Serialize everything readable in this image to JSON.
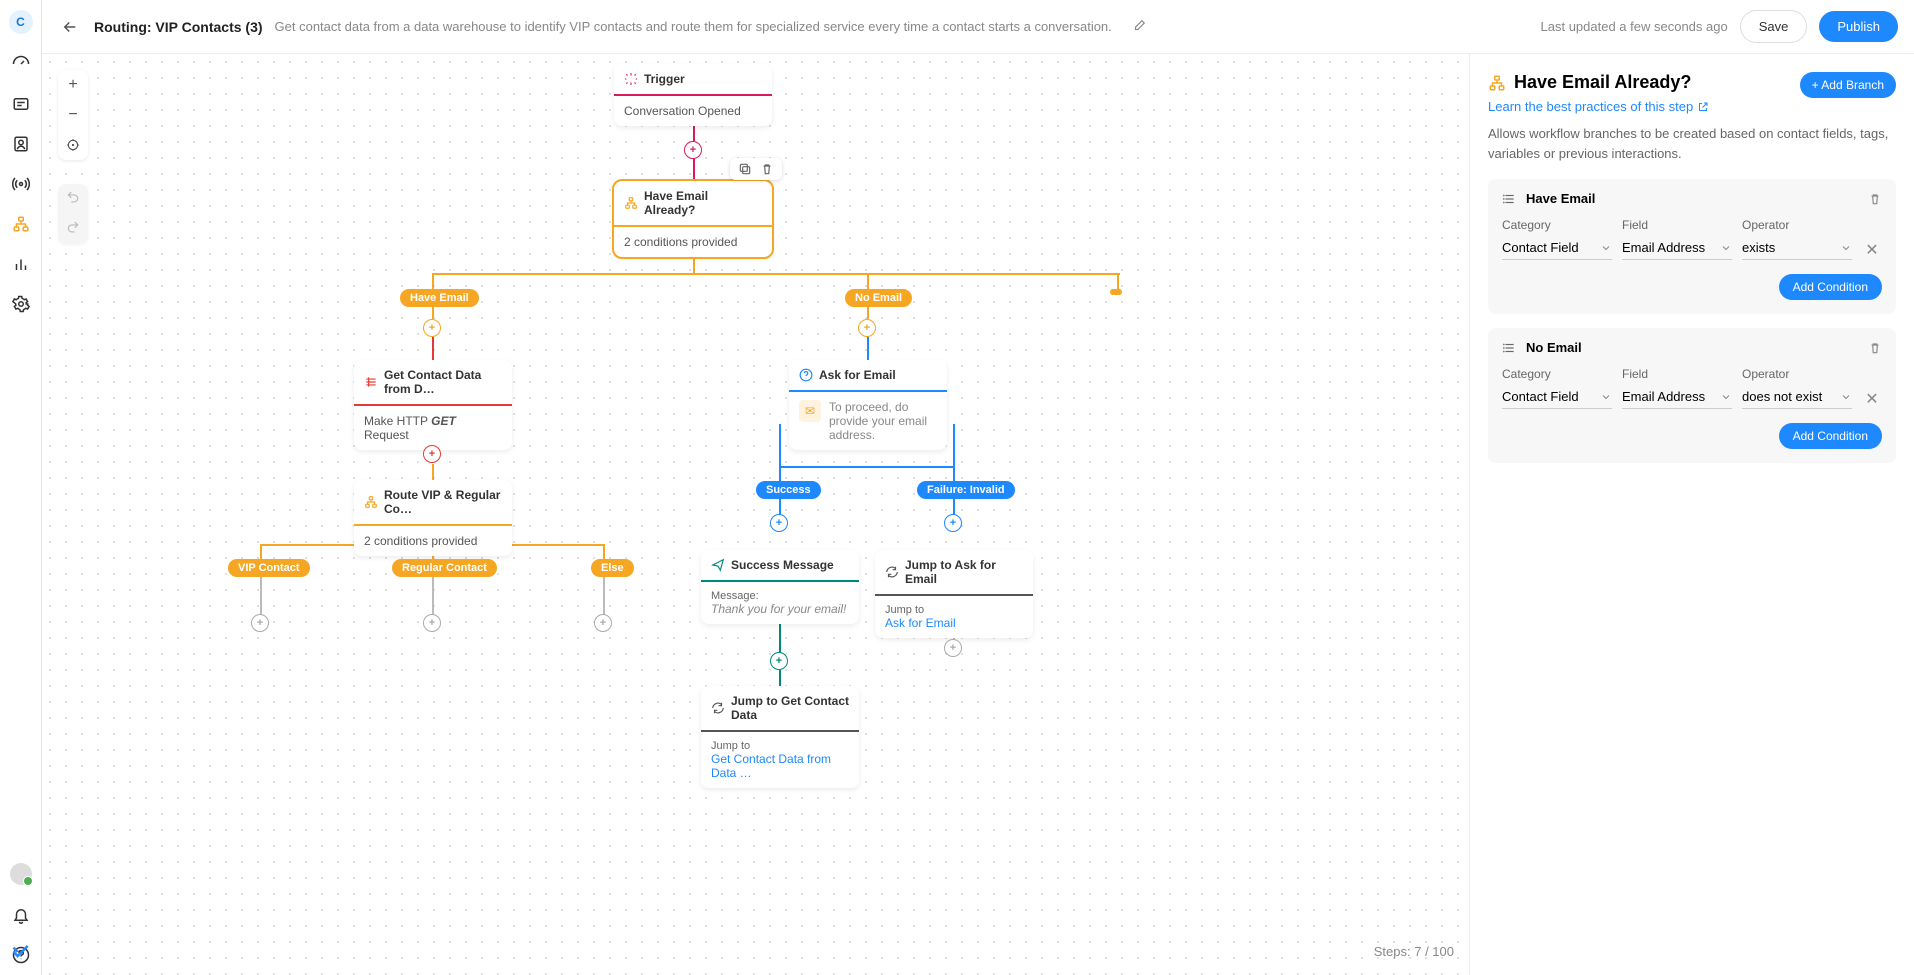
{
  "sidebar": {
    "logo_letter": "C"
  },
  "topbar": {
    "title": "Routing: VIP Contacts (3)",
    "description": "Get contact data from a data warehouse to identify VIP contacts and route them for specialized service every time a contact starts a conversation.",
    "last_updated": "Last updated a few seconds ago",
    "save_label": "Save",
    "publish_label": "Publish"
  },
  "nodes": {
    "trigger": {
      "title": "Trigger",
      "body": "Conversation Opened"
    },
    "have_email_branch": {
      "title": "Have Email Already?",
      "body": "2 conditions provided"
    },
    "get_contact": {
      "title": "Get Contact Data from D…",
      "line1_a": "Make HTTP ",
      "line1_b": "GET",
      "line1_c": " Request"
    },
    "route_vip": {
      "title": "Route VIP & Regular Co…",
      "body": "2 conditions provided"
    },
    "ask_email": {
      "title": "Ask for Email",
      "body": "To proceed, do provide your email address."
    },
    "success_msg": {
      "title": "Success Message",
      "label": "Message:",
      "content": "Thank you for your email!"
    },
    "jump_ask": {
      "title": "Jump to Ask for Email",
      "label": "Jump to",
      "target": "Ask for Email"
    },
    "jump_get": {
      "title": "Jump to Get Contact Data",
      "label": "Jump to",
      "target": "Get Contact Data from Data …"
    }
  },
  "pills": {
    "have_email": "Have Email",
    "no_email": "No Email",
    "vip": "VIP Contact",
    "regular": "Regular Contact",
    "else": "Else",
    "success": "Success",
    "failure": "Failure: Invalid"
  },
  "panel": {
    "title": "Have Email Already?",
    "learn_link": "Learn the best practices of this step",
    "add_branch": "+ Add Branch",
    "description": "Allows workflow branches to be created based on contact fields, tags, variables or previous interactions.",
    "labels": {
      "category": "Category",
      "field": "Field",
      "operator": "Operator"
    },
    "add_condition": "Add Condition",
    "branches": [
      {
        "name": "Have Email",
        "category": "Contact Field",
        "field": "Email Address",
        "operator": "exists"
      },
      {
        "name": "No Email",
        "category": "Contact Field",
        "field": "Email Address",
        "operator": "does not exist"
      }
    ]
  },
  "steps": {
    "label": "Steps: ",
    "count": "7 / 100"
  }
}
